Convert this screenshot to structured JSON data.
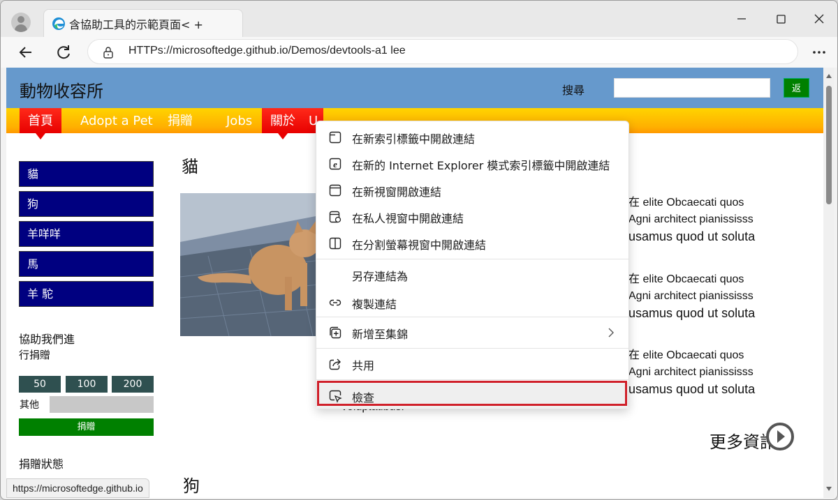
{
  "browser": {
    "tab_title": "含協助工具的示範頁面< +",
    "url": "HTTPs://microsoftedge.github.io/Demos/devtools-a1 lee",
    "status_url": "https://microsoftedge.github.io"
  },
  "site": {
    "title": "動物收容所",
    "search_label": "搜尋",
    "search_value": "",
    "search_button": "返",
    "nav": [
      "首頁",
      "Adopt a Pet",
      "捐贈",
      "Jobs",
      "關於",
      "U"
    ],
    "sidebar": [
      "貓",
      "狗",
      "羊咩咩",
      "馬",
      "羊 駝"
    ],
    "donate": {
      "heading_line1": "協助我們進",
      "heading_line2": "行捐贈",
      "amounts": [
        "50",
        "100",
        "200"
      ],
      "other_label": "其他",
      "button": "捐贈",
      "status_heading": "捐贈狀態"
    },
    "section_cat": "貓",
    "section_dog": "狗",
    "text_blocks": [
      {
        "l1": "在 elite Obcaecati quos",
        "l2": "Agni architect pianississs",
        "l3": "usamus quod ut soluta"
      },
      {
        "l1": "在 elite Obcaecati quos",
        "l2": "Agni architect pianississs",
        "l3": "usamus quod ut soluta"
      },
      {
        "l1": "在 elite Obcaecati quos",
        "l2": "Agni architect pianississs",
        "l3": "usamus quod ut soluta"
      }
    ],
    "voluptatibus": "voluptatibus.",
    "more_info": "更多資訊"
  },
  "context_menu": {
    "items": [
      {
        "label": "在新索引標籤中開啟連結",
        "icon": "new-tab-icon"
      },
      {
        "label": "在新的 Internet Explorer 模式索引標籤中開啟連結",
        "icon": "internet-explorer-icon"
      },
      {
        "label": "在新視窗開啟連結",
        "icon": "new-window-icon"
      },
      {
        "label": "在私人視窗中開啟連結",
        "icon": "inprivate-window-icon"
      },
      {
        "label": "在分割螢幕視窗中開啟連結",
        "icon": "split-screen-icon"
      },
      {
        "label": "另存連結為",
        "icon": ""
      },
      {
        "label": "複製連結",
        "icon": "link-icon"
      },
      {
        "label": "新增至集錦",
        "icon": "collections-icon"
      },
      {
        "label": "共用",
        "icon": "share-icon"
      },
      {
        "label": "檢查",
        "icon": "inspect-icon"
      }
    ]
  }
}
